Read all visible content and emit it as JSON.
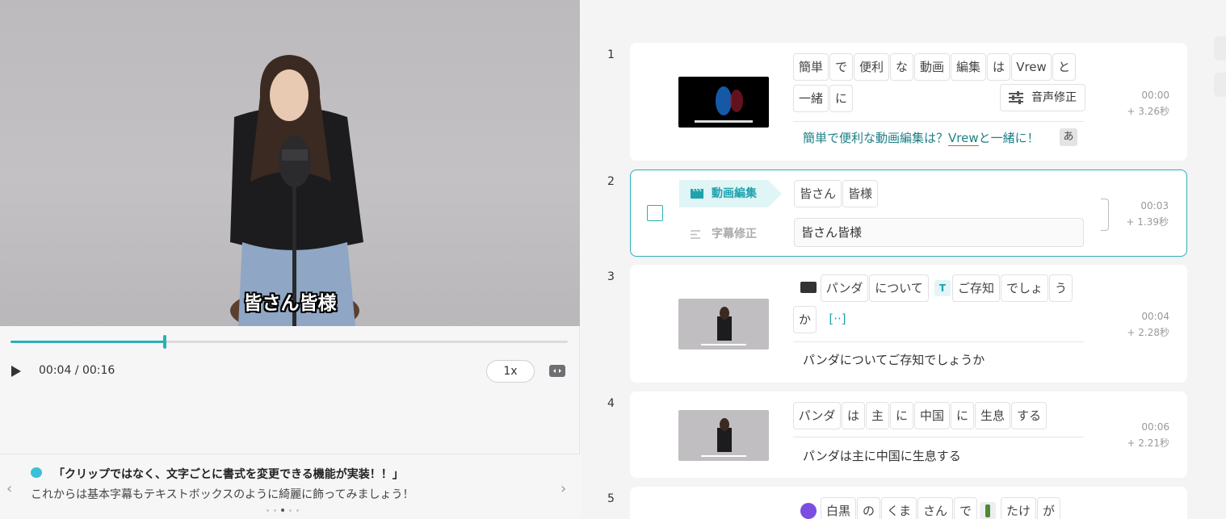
{
  "player": {
    "caption": "皆さん皆様",
    "time": "00:04 / 00:16",
    "progress_fraction": 0.277,
    "speed": "1x"
  },
  "news": {
    "title": "「クリップではなく、文字ごとに書式を変更できる機能が実装！！」",
    "body": "これからは基本字幕もテキストボックスのように綺麗に飾ってみましょう！",
    "prev": "‹",
    "next": "›",
    "dots": 5,
    "active_dot": 2
  },
  "clips": [
    {
      "num": "1",
      "words_row1": [
        "簡単",
        "で",
        "便利",
        "な",
        "動画",
        "編集",
        "は",
        "Vrew",
        "と"
      ],
      "words_row2": [
        "一緒",
        "に"
      ],
      "voice_button": "音声修正",
      "subtitle_pre": "簡単で便利な動画編集は？",
      "subtitle_under": "Vrew",
      "subtitle_post": "と一緒に！",
      "badge": "あ",
      "time": "00:00",
      "duration": "+ 3.26秒"
    },
    {
      "num": "2",
      "tab_edit": "動画編集",
      "tab_sub": "字幕修正",
      "words_row1": [
        "皆さん",
        "皆様"
      ],
      "subtitle": "皆さん皆様",
      "time": "00:03",
      "duration": "+ 1.39秒"
    },
    {
      "num": "3",
      "words_row1": [
        "パンダ",
        "について",
        "ご存知",
        "でしょ",
        "う"
      ],
      "words_row2": [
        "か",
        "[··]"
      ],
      "subtitle": "パンダについてご存知でしょうか",
      "time": "00:04",
      "duration": "+ 2.28秒"
    },
    {
      "num": "4",
      "words_row1": [
        "パンダ",
        "は",
        "主",
        "に",
        "中国",
        "に",
        "生息",
        "する"
      ],
      "subtitle": "パンダは主に中国に生息する",
      "time": "00:06",
      "duration": "+ 2.21秒"
    },
    {
      "num": "5",
      "words_row1": [
        "白黒",
        "の",
        "くま",
        "さん",
        "で",
        "たけ",
        "が"
      ]
    }
  ],
  "colors": {
    "accent": "#2ab0b8",
    "subtitle_teal": "#1e7f86"
  }
}
